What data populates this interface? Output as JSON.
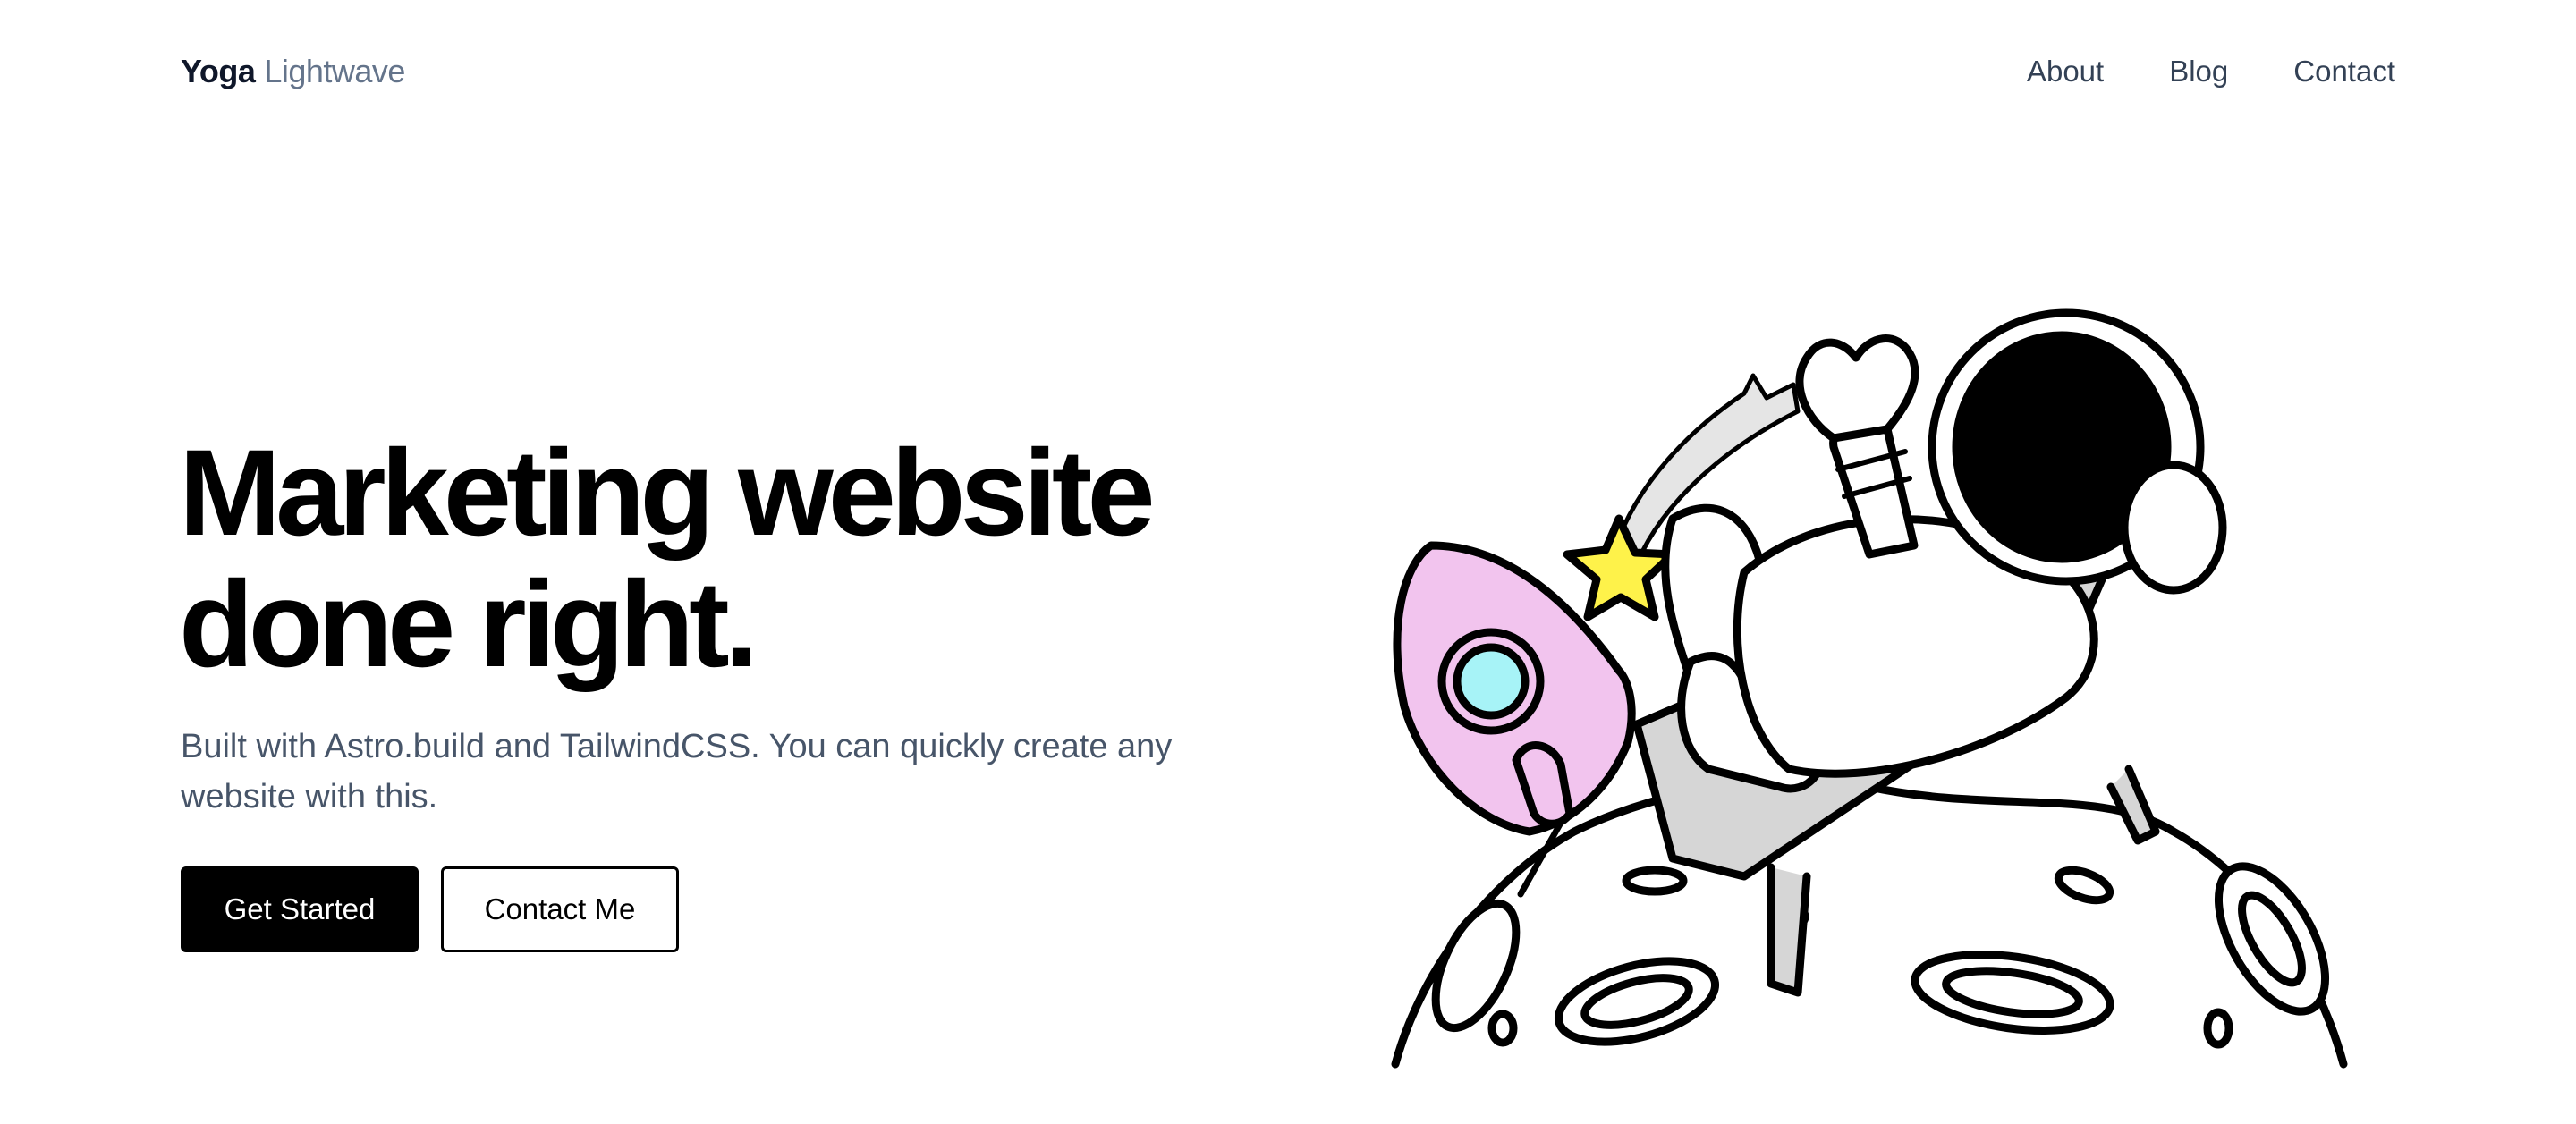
{
  "header": {
    "logo_bold": "Yoga",
    "logo_light": "Lightwave",
    "nav": [
      {
        "label": "About"
      },
      {
        "label": "Blog"
      },
      {
        "label": "Contact"
      }
    ]
  },
  "hero": {
    "title_line1": "Marketing website",
    "title_line2": "done right.",
    "subtitle": "Built with Astro.build and TailwindCSS. You can quickly create any website with this.",
    "primary_button": "Get Started",
    "secondary_button": "Contact Me"
  },
  "illustration": {
    "name": "astronaut-relaxing-on-moon",
    "colors": {
      "rocket": "#f2c4ee",
      "window": "#a7f3f7",
      "star": "#fef24a",
      "chair": "#d6d6d6",
      "helmet_visor": "#000000",
      "outline": "#000000"
    }
  }
}
